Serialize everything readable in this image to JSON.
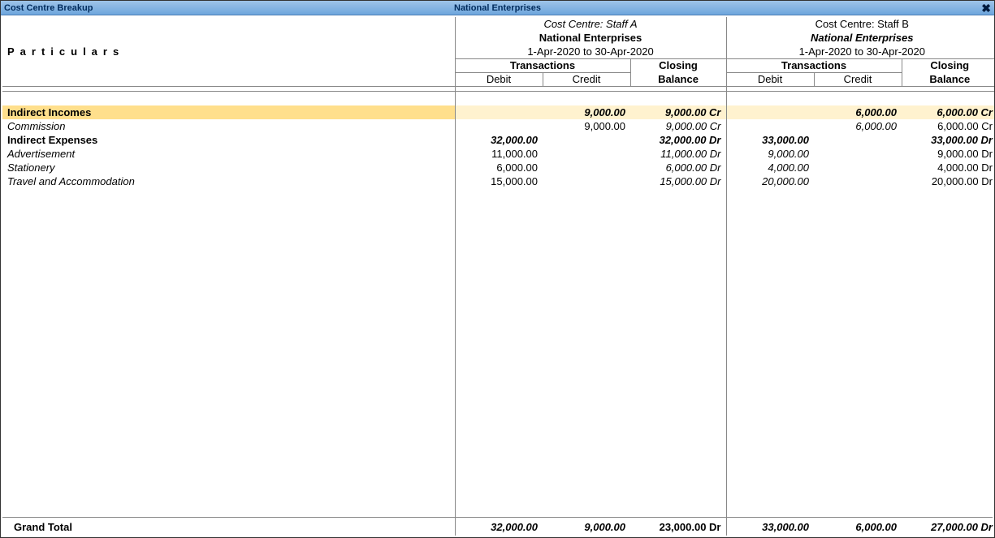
{
  "titlebar": {
    "left": "Cost Centre Breakup",
    "center": "National Enterprises"
  },
  "header": {
    "particulars": "Particulars",
    "sections": [
      {
        "cc_line": "Cost Centre: Staff A",
        "company": "National Enterprises",
        "period": "1-Apr-2020 to 30-Apr-2020",
        "company_style": "bold"
      },
      {
        "cc_line": "Cost Centre: Staff B",
        "company": "National Enterprises",
        "period": "1-Apr-2020 to 30-Apr-2020",
        "company_style": "bold-italic"
      }
    ],
    "transactions": "Transactions",
    "closing": "Closing",
    "balance": "Balance",
    "debit": "Debit",
    "credit": "Credit"
  },
  "rows": {
    "r0": {
      "label": "Indirect Incomes",
      "a_debit": "",
      "a_credit": "9,000.00",
      "a_bal": "9,000.00 Cr",
      "b_debit": "",
      "b_credit": "6,000.00",
      "b_bal": "6,000.00 Cr"
    },
    "r1": {
      "label": "Commission",
      "a_debit": "",
      "a_credit": "9,000.00",
      "a_bal": "9,000.00 Cr",
      "b_debit": "",
      "b_credit": "6,000.00",
      "b_bal": "6,000.00 Cr"
    },
    "r2": {
      "label": "Indirect Expenses",
      "a_debit": "32,000.00",
      "a_credit": "",
      "a_bal": "32,000.00 Dr",
      "b_debit": "33,000.00",
      "b_credit": "",
      "b_bal": "33,000.00 Dr"
    },
    "r3": {
      "label": "Advertisement",
      "a_debit": "11,000.00",
      "a_credit": "",
      "a_bal": "11,000.00 Dr",
      "b_debit": "9,000.00",
      "b_credit": "",
      "b_bal": "9,000.00 Dr"
    },
    "r4": {
      "label": "Stationery",
      "a_debit": "6,000.00",
      "a_credit": "",
      "a_bal": "6,000.00 Dr",
      "b_debit": "4,000.00",
      "b_credit": "",
      "b_bal": "4,000.00 Dr"
    },
    "r5": {
      "label": "Travel and Accommodation",
      "a_debit": "15,000.00",
      "a_credit": "",
      "a_bal": "15,000.00 Dr",
      "b_debit": "20,000.00",
      "b_credit": "",
      "b_bal": "20,000.00 Dr"
    }
  },
  "footer": {
    "label": "Grand Total",
    "a_debit": "32,000.00",
    "a_credit": "9,000.00",
    "a_bal": "23,000.00 Dr",
    "b_debit": "33,000.00",
    "b_credit": "6,000.00",
    "b_bal": "27,000.00 Dr"
  }
}
